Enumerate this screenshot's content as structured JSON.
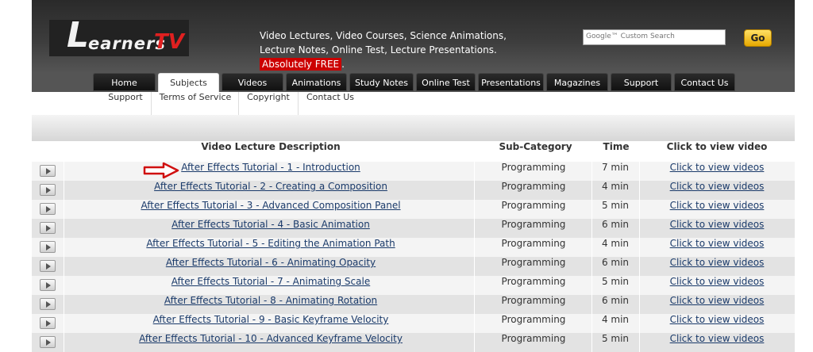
{
  "header": {
    "logo_letter": "L",
    "logo_rest": "earners",
    "logo_tv": "TV",
    "tagline": "Video Lectures, Video Courses, Science Animations, Lecture Notes, Online Test, Lecture Presentations.",
    "tagline_badge": "Absolutely FREE",
    "tagline_end": ".",
    "search_placeholder": "Google™ Custom Search",
    "go_label": "Go"
  },
  "nav": {
    "tabs": [
      "Home",
      "Subjects",
      "Videos",
      "Animations",
      "Study Notes",
      "Online Test",
      "Presentations",
      "Magazines",
      "Support",
      "Contact Us"
    ],
    "active": "Subjects"
  },
  "subnav": [
    "Support",
    "Terms of Service",
    "Copyright",
    "Contact Us"
  ],
  "table": {
    "headers": [
      "Video Lecture Description",
      "Sub-Category",
      "Time",
      "Click to view video"
    ],
    "rows": [
      {
        "title": "After Effects Tutorial - 1 - Introduction",
        "category": "Programming",
        "time": "7 min",
        "view": "Click to view videos"
      },
      {
        "title": "After Effects Tutorial - 2 - Creating a Composition",
        "category": "Programming",
        "time": "4 min",
        "view": "Click to view videos"
      },
      {
        "title": "After Effects Tutorial - 3 - Advanced Composition Panel",
        "category": "Programming",
        "time": "5 min",
        "view": "Click to view videos"
      },
      {
        "title": "After Effects Tutorial - 4 - Basic Animation",
        "category": "Programming",
        "time": "6 min",
        "view": "Click to view videos"
      },
      {
        "title": "After Effects Tutorial - 5 - Editing the Animation Path",
        "category": "Programming",
        "time": "4 min",
        "view": "Click to view videos"
      },
      {
        "title": "After Effects Tutorial - 6 - Animating Opacity",
        "category": "Programming",
        "time": "6 min",
        "view": "Click to view videos"
      },
      {
        "title": "After Effects Tutorial - 7 - Animating Scale",
        "category": "Programming",
        "time": "5 min",
        "view": "Click to view videos"
      },
      {
        "title": "After Effects Tutorial - 8 - Animating Rotation",
        "category": "Programming",
        "time": "6 min",
        "view": "Click to view videos"
      },
      {
        "title": "After Effects Tutorial - 9 - Basic Keyframe Velocity",
        "category": "Programming",
        "time": "4 min",
        "view": "Click to view videos"
      },
      {
        "title": "After Effects Tutorial - 10 - Advanced Keyframe Velocity",
        "category": "Programming",
        "time": "5 min",
        "view": "Click to view videos"
      }
    ]
  },
  "colors": {
    "accent_red": "#cc0000",
    "link": "#1a3a6a",
    "tab_bg": "#111111"
  }
}
